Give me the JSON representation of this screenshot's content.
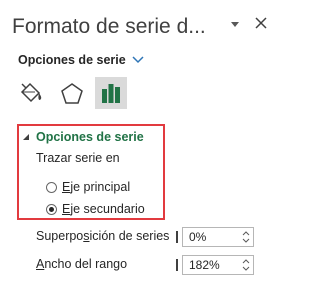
{
  "pane": {
    "title": "Formato de serie d...",
    "menu_label": "Opciones de serie",
    "tabs": [
      {
        "icon": "paint-bucket-icon"
      },
      {
        "icon": "pentagon-icon"
      },
      {
        "icon": "bar-chart-icon",
        "active": true
      }
    ]
  },
  "section": {
    "header": "Opciones de serie",
    "plot_on_label": "Trazar serie en",
    "primary_axis": {
      "underlined": "E",
      "rest": "je principal",
      "selected": false
    },
    "secondary_axis": {
      "underlined": "E",
      "rest": "je secundario",
      "selected": true
    }
  },
  "fields": {
    "overlap": {
      "label_before": "Superpo",
      "label_underlined": "s",
      "label_after": "ición de series",
      "value": "0%"
    },
    "gap_width": {
      "label_underlined": "A",
      "label_after": "ncho del rango",
      "value": "182%"
    }
  },
  "colors": {
    "accent_green": "#217346",
    "highlight_red": "#e23a3f",
    "active_tab_bg": "#dadada"
  }
}
